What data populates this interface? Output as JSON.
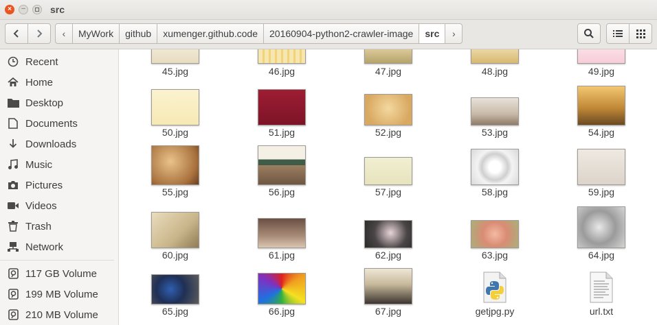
{
  "window": {
    "title": "src"
  },
  "toolbar": {
    "breadcrumbs": [
      "MyWork",
      "github",
      "xumenger.github.code",
      "20160904-python2-crawler-image",
      "src"
    ]
  },
  "sidebar": {
    "items": [
      {
        "label": "Recent",
        "icon": "clock-icon"
      },
      {
        "label": "Home",
        "icon": "home-icon"
      },
      {
        "label": "Desktop",
        "icon": "folder-icon"
      },
      {
        "label": "Documents",
        "icon": "document-icon"
      },
      {
        "label": "Downloads",
        "icon": "download-icon"
      },
      {
        "label": "Music",
        "icon": "music-icon"
      },
      {
        "label": "Pictures",
        "icon": "camera-icon"
      },
      {
        "label": "Videos",
        "icon": "video-icon"
      },
      {
        "label": "Trash",
        "icon": "trash-icon"
      },
      {
        "label": "Network",
        "icon": "network-icon"
      },
      {
        "label": "117 GB Volume",
        "icon": "drive-icon"
      },
      {
        "label": "199 MB Volume",
        "icon": "drive-icon"
      },
      {
        "label": "210 MB Volume",
        "icon": "drive-icon"
      }
    ]
  },
  "files": [
    {
      "name": "45.jpg",
      "thumb": "linear-gradient(#f3ecd9,#e8dcc0)"
    },
    {
      "name": "46.jpg",
      "thumb": "repeating-linear-gradient(90deg,#f6e7b0 0 6px,#f2d37a 6px 9px)"
    },
    {
      "name": "47.jpg",
      "thumb": "linear-gradient(#e8d6a8,#b5a36b)"
    },
    {
      "name": "48.jpg",
      "thumb": "linear-gradient(#f1e3b8,#d8b870)"
    },
    {
      "name": "49.jpg",
      "thumb": "linear-gradient(#fbe3ea,#f7cdd8)"
    },
    {
      "name": "50.jpg",
      "thumb": "linear-gradient(#fbf3cf,#f6e9b4)"
    },
    {
      "name": "51.jpg",
      "thumb": "linear-gradient(#9e1d33,#7d1428)"
    },
    {
      "name": "52.jpg",
      "thumb": "radial-gradient(circle at 50% 45%,#f3d8a0,#d9a962 75%)"
    },
    {
      "name": "53.jpg",
      "thumb": "linear-gradient(#e7e2da,#c8b9a7 60%,#8e7b69)"
    },
    {
      "name": "54.jpg",
      "thumb": "linear-gradient(#f3c771,#c28a38 55%,#6b4a22)"
    },
    {
      "name": "55.jpg",
      "thumb": "radial-gradient(circle at 40% 40%,#e9c38a,#a9713d 70%,#6a3f1f)"
    },
    {
      "name": "56.jpg",
      "thumb": "linear-gradient(#f4f0e6 0 35%,#3f5c49 35% 50%,#9c7f61 50%,#6e5641)"
    },
    {
      "name": "57.jpg",
      "thumb": "linear-gradient(#f1efd2,#e7e3bd)"
    },
    {
      "name": "58.jpg",
      "thumb": "radial-gradient(circle at 50% 50%,#ffffff 20%,#cfcfcf 45%,#f3f3f3 60%,#d9d9d9)"
    },
    {
      "name": "59.jpg",
      "thumb": "linear-gradient(#efe9e2,#dcd4ca)"
    },
    {
      "name": "60.jpg",
      "thumb": "linear-gradient(135deg,#e9ddbd,#c9b58a 60%,#8f7b55)"
    },
    {
      "name": "61.jpg",
      "thumb": "linear-gradient(#6a5044,#a98c78 60%,#d9c6b2)"
    },
    {
      "name": "62.jpg",
      "thumb": "radial-gradient(circle at 55% 45%,#e8d4d8,#4a4547 55%,#2a2a2a)"
    },
    {
      "name": "63.jpg",
      "thumb": "radial-gradient(circle at 50% 50%,#f4b9a3,#d98c74 45%,#a9b07a)"
    },
    {
      "name": "64.jpg",
      "thumb": "radial-gradient(circle at 45% 50%,#e8e8e8,#9b9b9b 50%,#d5d5d5)"
    },
    {
      "name": "65.jpg",
      "thumb": "radial-gradient(circle at 40% 50%,#2f5fb0,#1f2f55 45%,#5c5c5c)"
    },
    {
      "name": "66.jpg",
      "thumb": "conic-gradient(#e02020,#f0a020,#f5e020,#30b040,#2070e0,#8030c0,#e02020)"
    },
    {
      "name": "67.jpg",
      "thumb": "linear-gradient(#efe7d6,#c6b89a 45%,#3c3530)"
    },
    {
      "name": "getjpg.py",
      "thumb": "python-file-icon"
    },
    {
      "name": "url.txt",
      "thumb": "text-file-icon"
    }
  ]
}
